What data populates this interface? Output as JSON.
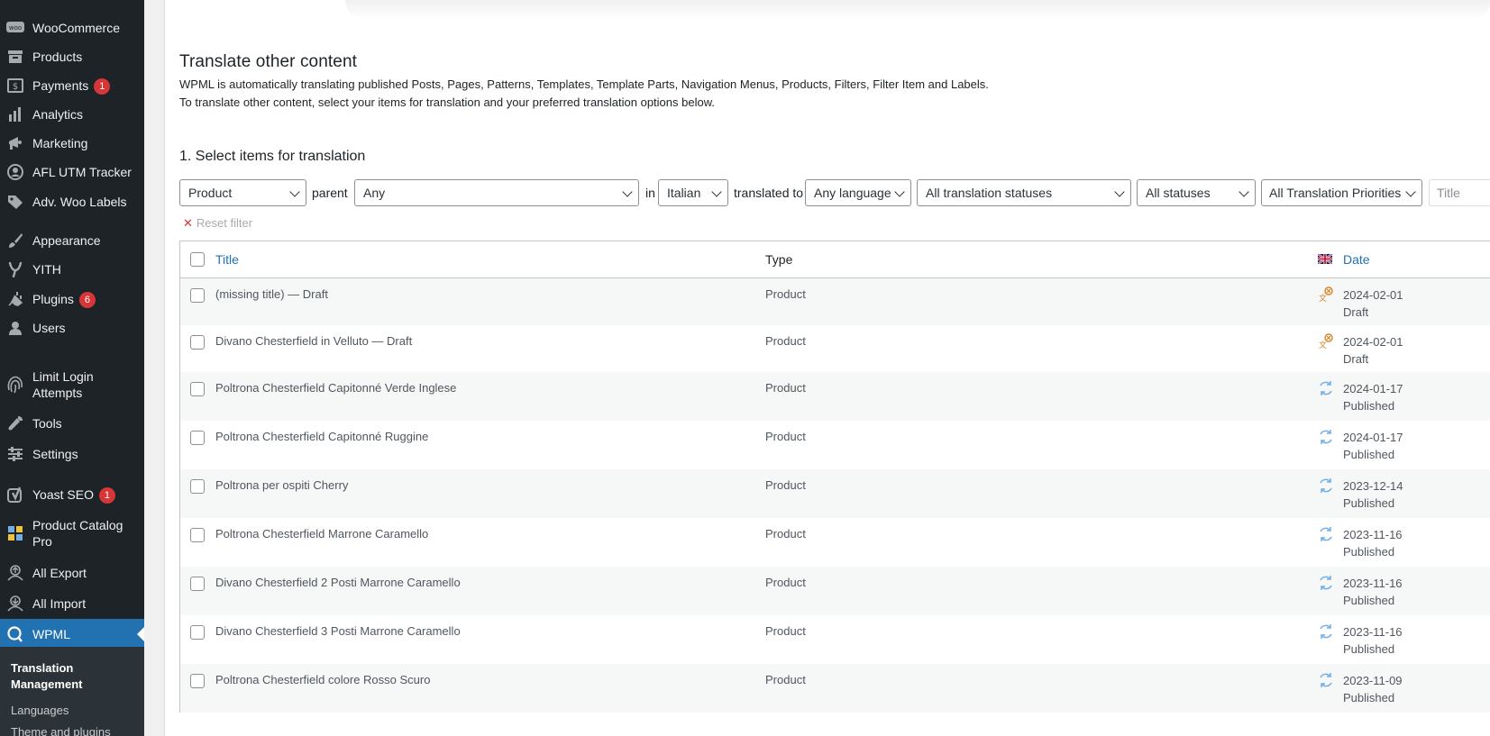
{
  "sidebar": {
    "items": [
      {
        "label": "WooCommerce",
        "icon": "woo-icon",
        "badge": ""
      },
      {
        "label": "Products",
        "icon": "archive-icon",
        "badge": ""
      },
      {
        "label": "Payments",
        "icon": "dollar-icon",
        "badge": "1"
      },
      {
        "label": "Analytics",
        "icon": "bar-chart-icon",
        "badge": ""
      },
      {
        "label": "Marketing",
        "icon": "megaphone-icon",
        "badge": ""
      },
      {
        "label": "AFL UTM Tracker",
        "icon": "user-circle-icon",
        "badge": ""
      },
      {
        "label": "Adv. Woo Labels",
        "icon": "tag-icon",
        "badge": ""
      },
      {
        "label": "Appearance",
        "icon": "paintbrush-icon",
        "badge": ""
      },
      {
        "label": "YITH",
        "icon": "yith-icon",
        "badge": ""
      },
      {
        "label": "Plugins",
        "icon": "plug-icon",
        "badge": "6"
      },
      {
        "label": "Users",
        "icon": "user-icon",
        "badge": ""
      },
      {
        "label": "Limit Login Attempts",
        "icon": "fingerprint-icon",
        "badge": ""
      },
      {
        "label": "Tools",
        "icon": "wrench-icon",
        "badge": ""
      },
      {
        "label": "Settings",
        "icon": "settings-sliders-icon",
        "badge": ""
      },
      {
        "label": "Yoast SEO",
        "icon": "yoast-icon",
        "badge": "1"
      },
      {
        "label": "Product Catalog Pro",
        "icon": "grid-icon",
        "badge": ""
      },
      {
        "label": "All Export",
        "icon": "export-icon",
        "badge": ""
      },
      {
        "label": "All Import",
        "icon": "import-icon",
        "badge": ""
      },
      {
        "label": "WPML",
        "icon": "wpml-icon",
        "badge": ""
      }
    ],
    "submenu": {
      "current": "Translation Management",
      "items": [
        "Languages",
        "Theme and plugins"
      ]
    }
  },
  "page": {
    "title": "Translate other content",
    "intro_line1": "WPML is automatically translating published Posts, Pages, Patterns, Templates, Template Parts, Navigation Menus, Products, Filters, Filter Item and Labels.",
    "intro_line2": "To translate other content, select your items for translation and your preferred translation options below.",
    "section_title": "1. Select items for translation"
  },
  "filters": {
    "type": "Product",
    "parent_label": "parent",
    "parent": "Any",
    "in_label": "in",
    "source_language": "Italian",
    "translated_to_label": "translated to",
    "target_language": "Any language",
    "translation_status": "All translation statuses",
    "post_status": "All statuses",
    "priority": "All Translation Priorities",
    "title_placeholder": "Title",
    "reset_label": "Reset filter"
  },
  "table": {
    "columns": {
      "title": "Title",
      "type": "Type",
      "date": "Date"
    },
    "rows": [
      {
        "title": "(missing title) — Draft",
        "type": "Product",
        "date": "2024-02-01",
        "status": "Draft",
        "icon": "needs-translation-icon"
      },
      {
        "title": "Divano Chesterfield in Velluto — Draft",
        "type": "Product",
        "date": "2024-02-01",
        "status": "Draft",
        "icon": "needs-translation-icon"
      },
      {
        "title": "Poltrona Chesterfield Capitonné Verde Inglese",
        "type": "Product",
        "date": "2024-01-17",
        "status": "Published",
        "icon": "translation-in-progress-icon"
      },
      {
        "title": "Poltrona Chesterfield Capitonné Ruggine",
        "type": "Product",
        "date": "2024-01-17",
        "status": "Published",
        "icon": "translation-in-progress-icon"
      },
      {
        "title": "Poltrona per ospiti Cherry",
        "type": "Product",
        "date": "2023-12-14",
        "status": "Published",
        "icon": "translation-in-progress-icon"
      },
      {
        "title": "Poltrona Chesterfield Marrone Caramello",
        "type": "Product",
        "date": "2023-11-16",
        "status": "Published",
        "icon": "translation-in-progress-icon"
      },
      {
        "title": "Divano Chesterfield 2 Posti Marrone Caramello",
        "type": "Product",
        "date": "2023-11-16",
        "status": "Published",
        "icon": "translation-in-progress-icon"
      },
      {
        "title": "Divano Chesterfield 3 Posti Marrone Caramello",
        "type": "Product",
        "date": "2023-11-16",
        "status": "Published",
        "icon": "translation-in-progress-icon"
      },
      {
        "title": "Poltrona Chesterfield colore Rosso Scuro",
        "type": "Product",
        "date": "2023-11-09",
        "status": "Published",
        "icon": "translation-in-progress-icon"
      }
    ]
  },
  "colors": {
    "sidebar_bg": "#1d2327",
    "active_bg": "#2271b1",
    "badge": "#d63638",
    "link": "#2271b1",
    "needs_translation": "#d98324",
    "in_progress": "#72aee6"
  }
}
